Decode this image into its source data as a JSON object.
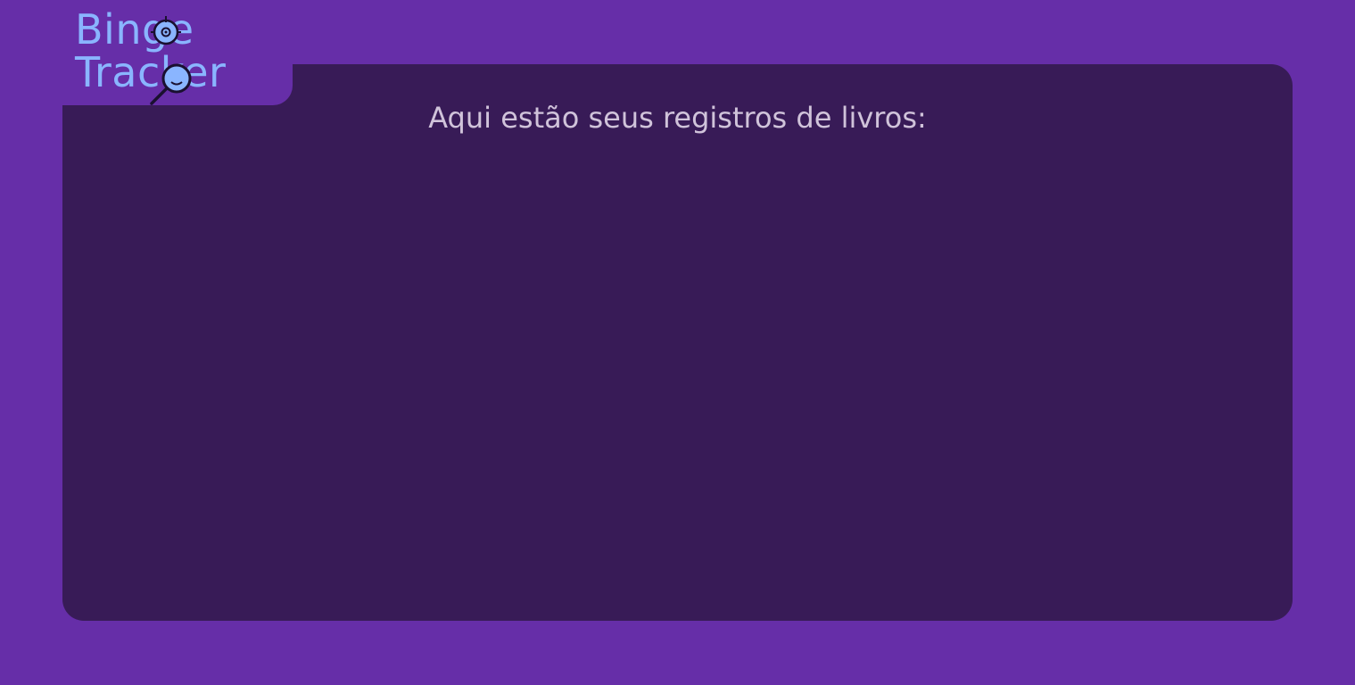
{
  "logo": {
    "line1": "Binge",
    "line2": "Tracker",
    "icons": [
      "crosshair-icon",
      "magnifier-icon"
    ]
  },
  "main": {
    "heading": "Aqui estão seus registros de livros:"
  },
  "colors": {
    "page_background": "#662ea8",
    "panel_background": "#381b57",
    "logo_text": "#8ab5ff",
    "heading_text": "#d0c3da"
  }
}
